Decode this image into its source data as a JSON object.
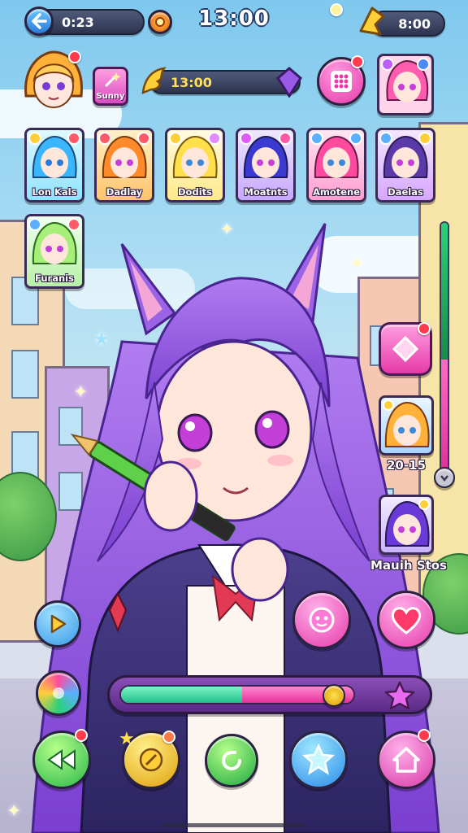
{
  "status_bar": {
    "time": "13:00",
    "left_counter": "0:23",
    "right_counter": "8:00"
  },
  "profile": {
    "name": "Sunny",
    "timer": "13:00"
  },
  "roster": [
    {
      "name": "Lon Kals",
      "palette": "#bff2ff"
    },
    {
      "name": "Dadlay",
      "palette": "#ffd98a"
    },
    {
      "name": "Dodits",
      "palette": "#fff2b0"
    },
    {
      "name": "Moatnts",
      "palette": "#d9c7ff"
    },
    {
      "name": "Amotene",
      "palette": "#ffc2df"
    },
    {
      "name": "Daelas",
      "palette": "#e7c9ff"
    },
    {
      "name": "Furanis",
      "palette": "#d4f7c0"
    }
  ],
  "side_panel": {
    "card1_caption": "20-15",
    "card2_caption": "Mauih Stos"
  },
  "progress": {
    "fill_a": 0.52,
    "fill_b": 0.48
  },
  "vertical_slider": {
    "level": 0.55
  },
  "icons": {
    "back": "back-arrow-icon",
    "emblem": "sun-emblem-icon",
    "crystal": "crystal-wing-icon",
    "grid": "grid-menu-icon",
    "play": "play-icon",
    "heart": "heart-icon",
    "home": "home-icon"
  },
  "colors": {
    "pink": "#ff3fb2",
    "purple": "#8a4fb8",
    "teal": "#2ad1a0",
    "red_badge": "#ff3b4d"
  }
}
